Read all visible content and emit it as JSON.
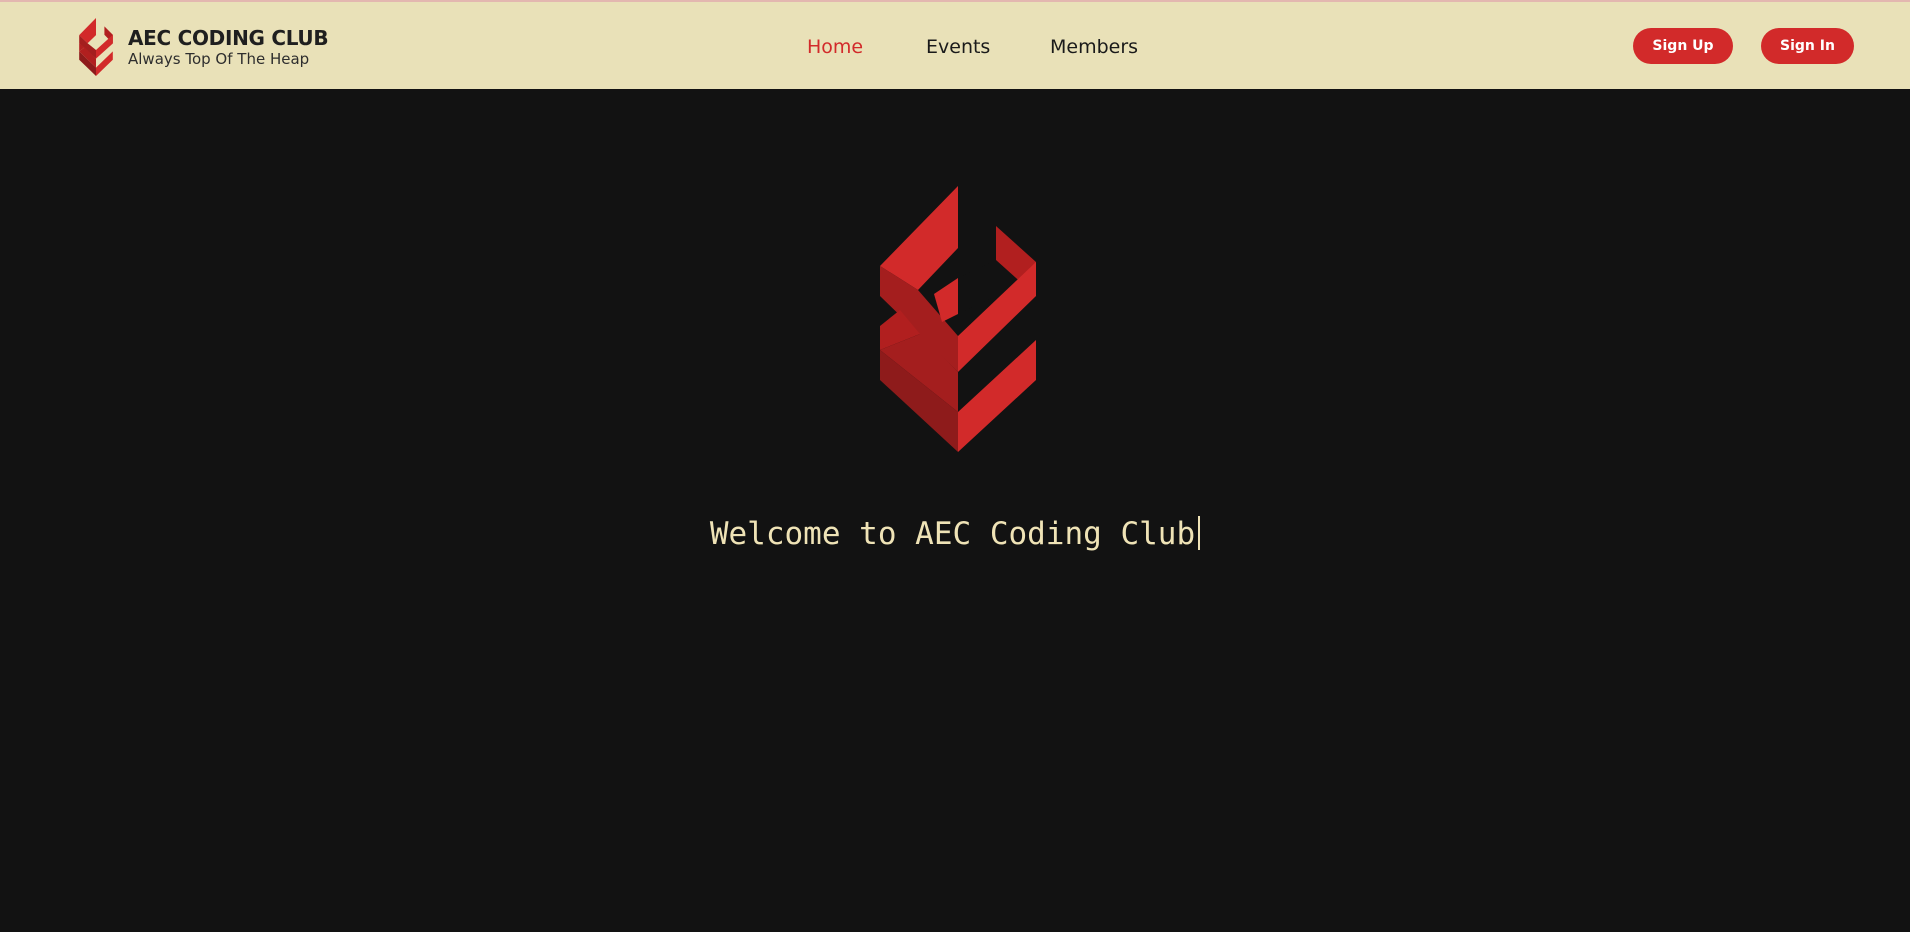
{
  "brand": {
    "title": "AEC CODING CLUB",
    "tagline": "Always Top Of The Heap",
    "logo_icon": "aec-diamond-logo-icon"
  },
  "nav": {
    "items": [
      {
        "label": "Home",
        "active": true
      },
      {
        "label": "Events",
        "active": false
      },
      {
        "label": "Members",
        "active": false
      }
    ]
  },
  "auth": {
    "sign_up_label": "Sign Up",
    "sign_in_label": "Sign In"
  },
  "hero": {
    "logo_icon": "aec-diamond-logo-icon",
    "welcome_text": "Welcome to AEC Coding Club"
  },
  "colors": {
    "navbar_bg": "#e9e1b8",
    "page_bg": "#121212",
    "accent_red": "#d22a2a",
    "welcome_text": "#efe3b6"
  }
}
